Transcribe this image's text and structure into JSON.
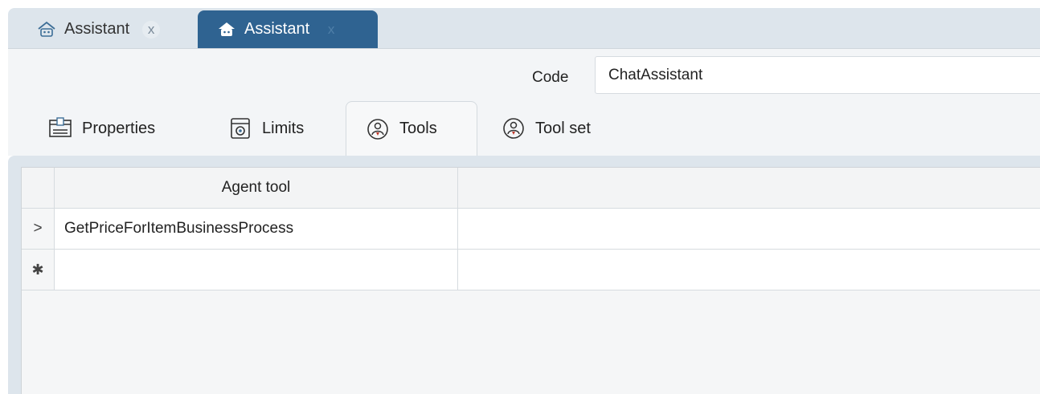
{
  "document_tabs": [
    {
      "label": "Assistant",
      "close": "x",
      "icon": "home-robot-icon",
      "active": false
    },
    {
      "label": "Assistant",
      "close": "x",
      "icon": "home-robot-icon",
      "active": true
    }
  ],
  "form": {
    "code_label": "Code",
    "code_value": "ChatAssistant"
  },
  "section_tabs": {
    "properties": {
      "label": "Properties",
      "icon": "properties-icon"
    },
    "limits": {
      "label": "Limits",
      "icon": "limits-icon"
    },
    "tools": {
      "label": "Tools",
      "icon": "tools-icon",
      "selected": true
    },
    "tool_set": {
      "label": "Tool set",
      "icon": "tool-set-icon"
    }
  },
  "grid": {
    "columns": [
      "Agent tool",
      ""
    ],
    "rows": [
      {
        "indicator": ">",
        "agent_tool": "GetPriceForItemBusinessProcess",
        "extra": ""
      }
    ],
    "new_row_indicator": "✱"
  },
  "colors": {
    "active_tab": "#2f6391",
    "tab_strip": "#dde5ec",
    "toolbar_bg": "#f3f5f7"
  }
}
